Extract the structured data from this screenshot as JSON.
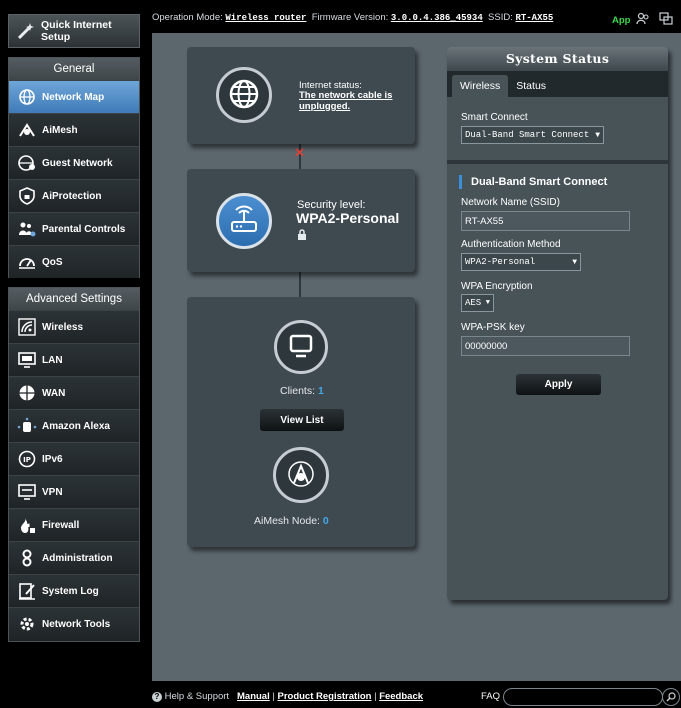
{
  "sidebar": {
    "qis_label": "Quick Internet Setup",
    "general_header": "General",
    "general_items": [
      {
        "label": "Network Map"
      },
      {
        "label": "AiMesh"
      },
      {
        "label": "Guest Network"
      },
      {
        "label": "AiProtection"
      },
      {
        "label": "Parental Controls"
      },
      {
        "label": "QoS"
      }
    ],
    "advanced_header": "Advanced Settings",
    "advanced_items": [
      {
        "label": "Wireless"
      },
      {
        "label": "LAN"
      },
      {
        "label": "WAN"
      },
      {
        "label": "Amazon Alexa"
      },
      {
        "label": "IPv6"
      },
      {
        "label": "VPN"
      },
      {
        "label": "Firewall"
      },
      {
        "label": "Administration"
      },
      {
        "label": "System Log"
      },
      {
        "label": "Network Tools"
      }
    ]
  },
  "topbar": {
    "op_mode_label": "Operation Mode:",
    "op_mode_value": "Wireless router",
    "fw_label": "Firmware Version:",
    "fw_value": "3.0.0.4.386_45934",
    "ssid_label": "SSID:",
    "ssid_value": "RT-AX55",
    "app_label": "App"
  },
  "map": {
    "internet_status_label": "Internet status:",
    "internet_status_value": "The network cable is unplugged.",
    "security_label": "Security level:",
    "security_value": "WPA2-Personal",
    "clients_label": "Clients:",
    "clients_count": "1",
    "view_list_label": "View List",
    "aimesh_label": "AiMesh Node:",
    "aimesh_count": "0"
  },
  "status_panel": {
    "title": "System Status",
    "tabs": [
      "Wireless",
      "Status"
    ],
    "smart_connect_label": "Smart Connect",
    "smart_connect_value": "Dual-Band Smart Connect",
    "section_title": "Dual-Band Smart Connect",
    "ssid_label": "Network Name (SSID)",
    "ssid_value": "RT-AX55",
    "auth_label": "Authentication Method",
    "auth_value": "WPA2-Personal",
    "enc_label": "WPA Encryption",
    "enc_value": "AES",
    "psk_label": "WPA-PSK key",
    "psk_value": "00000000",
    "apply_label": "Apply"
  },
  "footer": {
    "help_label": "Help & Support",
    "manual_label": "Manual",
    "registration_label": "Product Registration",
    "feedback_label": "Feedback",
    "faq_label": "FAQ"
  }
}
